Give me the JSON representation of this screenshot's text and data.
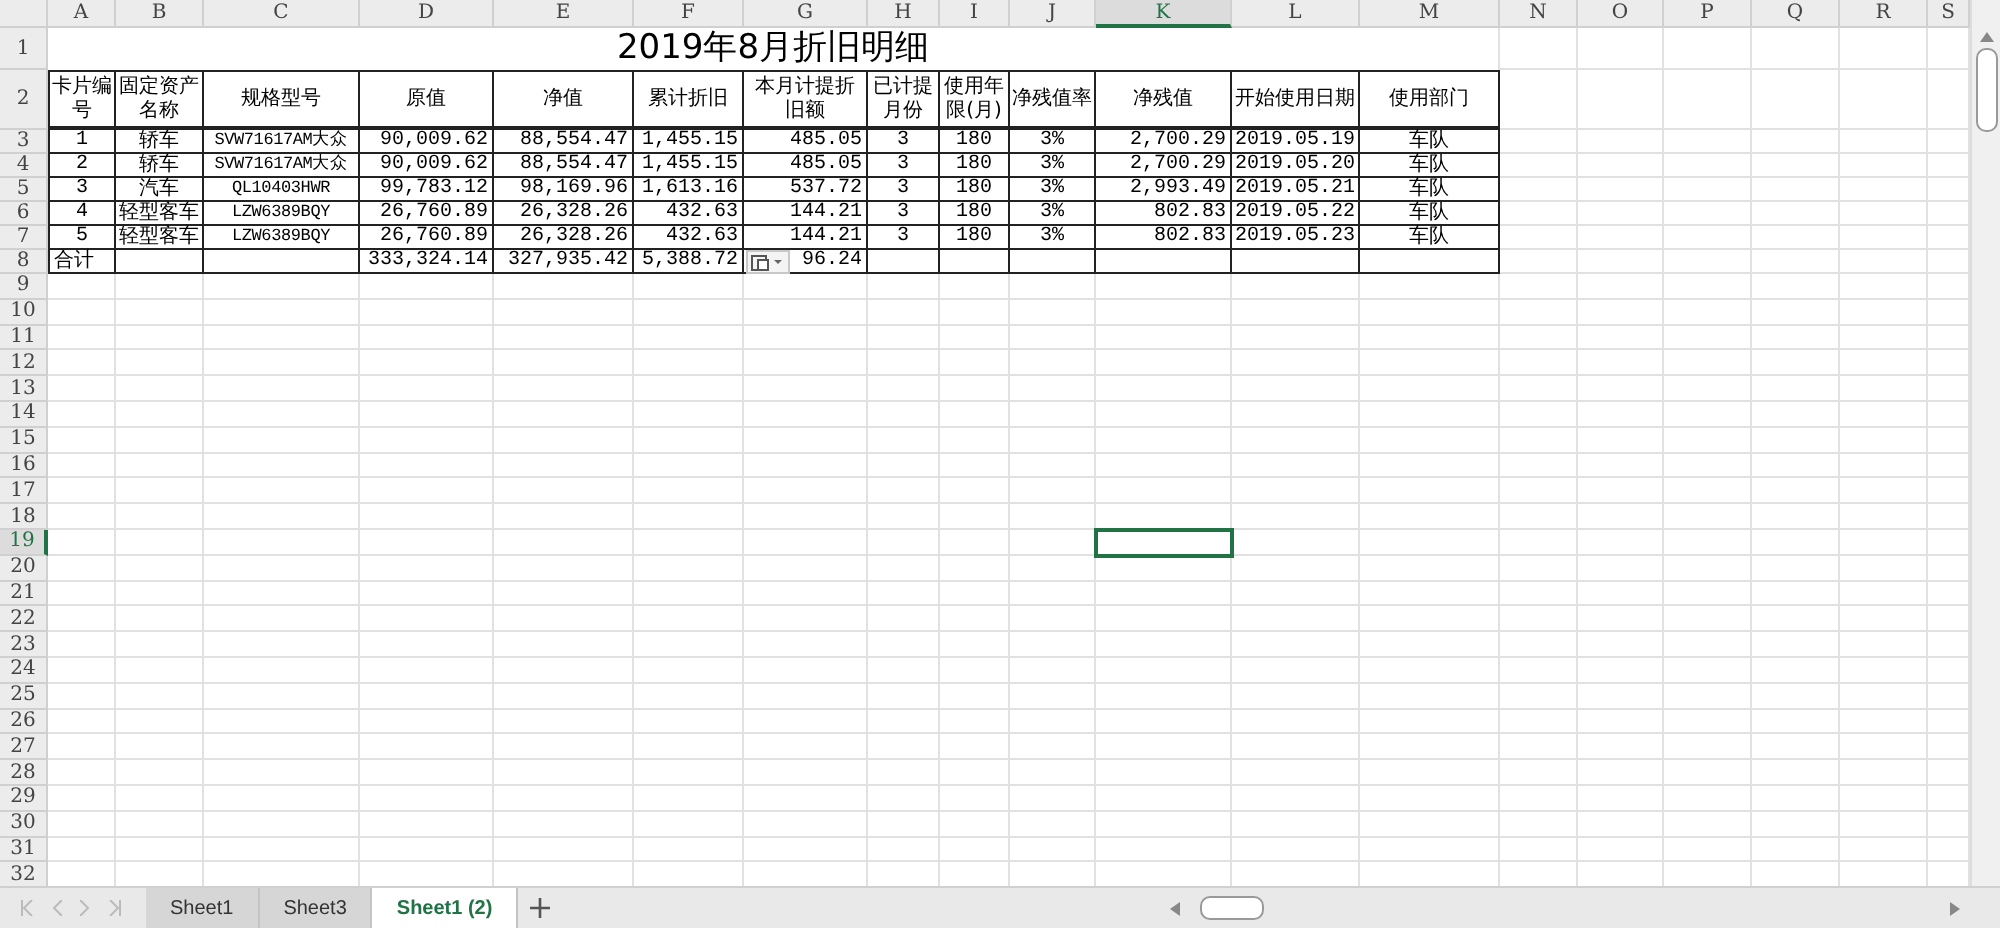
{
  "column_headers": [
    {
      "label": "A",
      "selected": false
    },
    {
      "label": "B",
      "selected": false
    },
    {
      "label": "C",
      "selected": false
    },
    {
      "label": "D",
      "selected": false
    },
    {
      "label": "E",
      "selected": false
    },
    {
      "label": "F",
      "selected": false
    },
    {
      "label": "G",
      "selected": false
    },
    {
      "label": "H",
      "selected": false
    },
    {
      "label": "I",
      "selected": false
    },
    {
      "label": "J",
      "selected": false
    },
    {
      "label": "K",
      "selected": true
    },
    {
      "label": "L",
      "selected": false
    },
    {
      "label": "M",
      "selected": false
    },
    {
      "label": "N",
      "selected": false
    },
    {
      "label": "O",
      "selected": false
    },
    {
      "label": "P",
      "selected": false
    },
    {
      "label": "Q",
      "selected": false
    },
    {
      "label": "R",
      "selected": false
    },
    {
      "label": "S",
      "selected": false
    }
  ],
  "row_headers": [
    {
      "label": "1",
      "selected": false
    },
    {
      "label": "2",
      "selected": false
    },
    {
      "label": "3",
      "selected": false
    },
    {
      "label": "4",
      "selected": false
    },
    {
      "label": "5",
      "selected": false
    },
    {
      "label": "6",
      "selected": false
    },
    {
      "label": "7",
      "selected": false
    },
    {
      "label": "8",
      "selected": false
    },
    {
      "label": "9",
      "selected": false
    },
    {
      "label": "10",
      "selected": false
    },
    {
      "label": "11",
      "selected": false
    },
    {
      "label": "12",
      "selected": false
    },
    {
      "label": "13",
      "selected": false
    },
    {
      "label": "14",
      "selected": false
    },
    {
      "label": "15",
      "selected": false
    },
    {
      "label": "16",
      "selected": false
    },
    {
      "label": "17",
      "selected": false
    },
    {
      "label": "18",
      "selected": false
    },
    {
      "label": "19",
      "selected": true
    },
    {
      "label": "20",
      "selected": false
    },
    {
      "label": "21",
      "selected": false
    },
    {
      "label": "22",
      "selected": false
    },
    {
      "label": "23",
      "selected": false
    },
    {
      "label": "24",
      "selected": false
    },
    {
      "label": "25",
      "selected": false
    },
    {
      "label": "26",
      "selected": false
    },
    {
      "label": "27",
      "selected": false
    },
    {
      "label": "28",
      "selected": false
    },
    {
      "label": "29",
      "selected": false
    },
    {
      "label": "30",
      "selected": false
    },
    {
      "label": "31",
      "selected": false
    },
    {
      "label": "32",
      "selected": false
    }
  ],
  "sheet_title": "2019年8月折旧明细",
  "table": {
    "columns": [
      "卡片编号",
      "固定资产名称",
      "规格型号",
      "原值",
      "净值",
      "累计折旧",
      "本月计提折旧额",
      "已计提月份",
      "使用年限(月)",
      "净残值率",
      "净残值",
      "开始使用日期",
      "使用部门"
    ],
    "rows": [
      [
        "1",
        "轿车",
        "SVW71617AM大众",
        "90,009.62",
        "88,554.47",
        "1,455.15",
        "485.05",
        "3",
        "180",
        "3%",
        "2,700.29",
        "2019.05.19",
        "车队"
      ],
      [
        "2",
        "轿车",
        "SVW71617AM大众",
        "90,009.62",
        "88,554.47",
        "1,455.15",
        "485.05",
        "3",
        "180",
        "3%",
        "2,700.29",
        "2019.05.20",
        "车队"
      ],
      [
        "3",
        "汽车",
        "QL10403HWR",
        "99,783.12",
        "98,169.96",
        "1,613.16",
        "537.72",
        "3",
        "180",
        "3%",
        "2,993.49",
        "2019.05.21",
        "车队"
      ],
      [
        "4",
        "轻型客车",
        "LZW6389BQY",
        "26,760.89",
        "26,328.26",
        "432.63",
        "144.21",
        "3",
        "180",
        "3%",
        "802.83",
        "2019.05.22",
        "车队"
      ],
      [
        "5",
        "轻型客车",
        "LZW6389BQY",
        "26,760.89",
        "26,328.26",
        "432.63",
        "144.21",
        "3",
        "180",
        "3%",
        "802.83",
        "2019.05.23",
        "车队"
      ]
    ],
    "total": {
      "label": "合计",
      "original_value": "333,324.14",
      "net_value": "327,935.42",
      "accumulated_depreciation": "5,388.72",
      "monthly_depreciation": "96.24"
    }
  },
  "sheet_tabs": [
    {
      "label": "Sheet1",
      "selected": false
    },
    {
      "label": "Sheet3",
      "selected": false
    },
    {
      "label": "Sheet1 (2)",
      "selected": true
    }
  ]
}
